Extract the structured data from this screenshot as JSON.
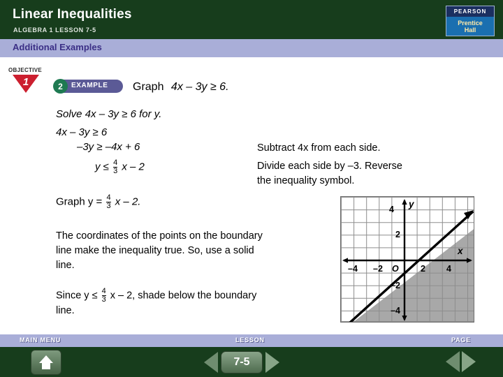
{
  "header": {
    "title": "Linear Inequalities",
    "subtitle": "ALGEBRA 1  LESSON 7-5",
    "logo_top": "PEARSON",
    "logo_line1": "Prentice",
    "logo_line2": "Hall"
  },
  "band": {
    "label": "Additional Examples"
  },
  "objective": {
    "word": "OBJECTIVE",
    "number": "1"
  },
  "example": {
    "number": "2",
    "label": "EXAMPLE"
  },
  "prompt": {
    "graph_word": "Graph",
    "inequality": "4x – 3y ≥ 6."
  },
  "solve": {
    "line": "Solve  4x – 3y ≥ 6  for y."
  },
  "steps": [
    {
      "math": "4x – 3y ≥ 6",
      "note": ""
    },
    {
      "math": "–3y ≥ –4x + 6",
      "note": "Subtract 4x from each side."
    },
    {
      "math_pre": "y ≤",
      "frac_n": "4",
      "frac_d": "3",
      "math_post": "x – 2",
      "note_line1": "Divide each side by –3. Reverse",
      "note_line2": "the inequality symbol."
    }
  ],
  "graph_instruction": {
    "pre": "Graph y  =",
    "frac_n": "4",
    "frac_d": "3",
    "post": "x  –  2."
  },
  "paragraph1": {
    "line1": "The coordinates of the points on the boundary",
    "line2": "line make the inequality true. So, use a solid",
    "line3": "line."
  },
  "paragraph2": {
    "pre": "Since y  ≤",
    "frac_n": "4",
    "frac_d": "3",
    "post": "x  –  2, shade below the boundary",
    "line2": "line."
  },
  "footer": {
    "main_menu": "MAIN MENU",
    "lesson_label": "LESSON",
    "page_label": "PAGE",
    "lesson_number": "7-5"
  },
  "chart_data": {
    "type": "line",
    "title": "",
    "xlabel": "x",
    "ylabel": "y",
    "xlim": [
      -5,
      5.5
    ],
    "ylim": [
      -5,
      5
    ],
    "grid": true,
    "x_ticks": [
      -4,
      -2,
      2,
      4
    ],
    "y_ticks": [
      -4,
      -2,
      2,
      4
    ],
    "origin_label": "O",
    "series": [
      {
        "name": "y = (4/3)x - 2",
        "type": "solid-boundary-line",
        "slope": 1.3333,
        "intercept": -2,
        "points": [
          [
            -2.25,
            -5
          ],
          [
            5.5,
            5.33
          ]
        ],
        "style": "solid",
        "color": "#000000"
      }
    ],
    "shaded_region": {
      "description": "below the line y = (4/3)x - 2",
      "inequality": "y <= (4/3)x - 2",
      "color": "#a8a8a8"
    },
    "colors": {
      "grid": "#8d8d8d",
      "axis": "#000000",
      "shade": "#a8a8a8"
    }
  }
}
